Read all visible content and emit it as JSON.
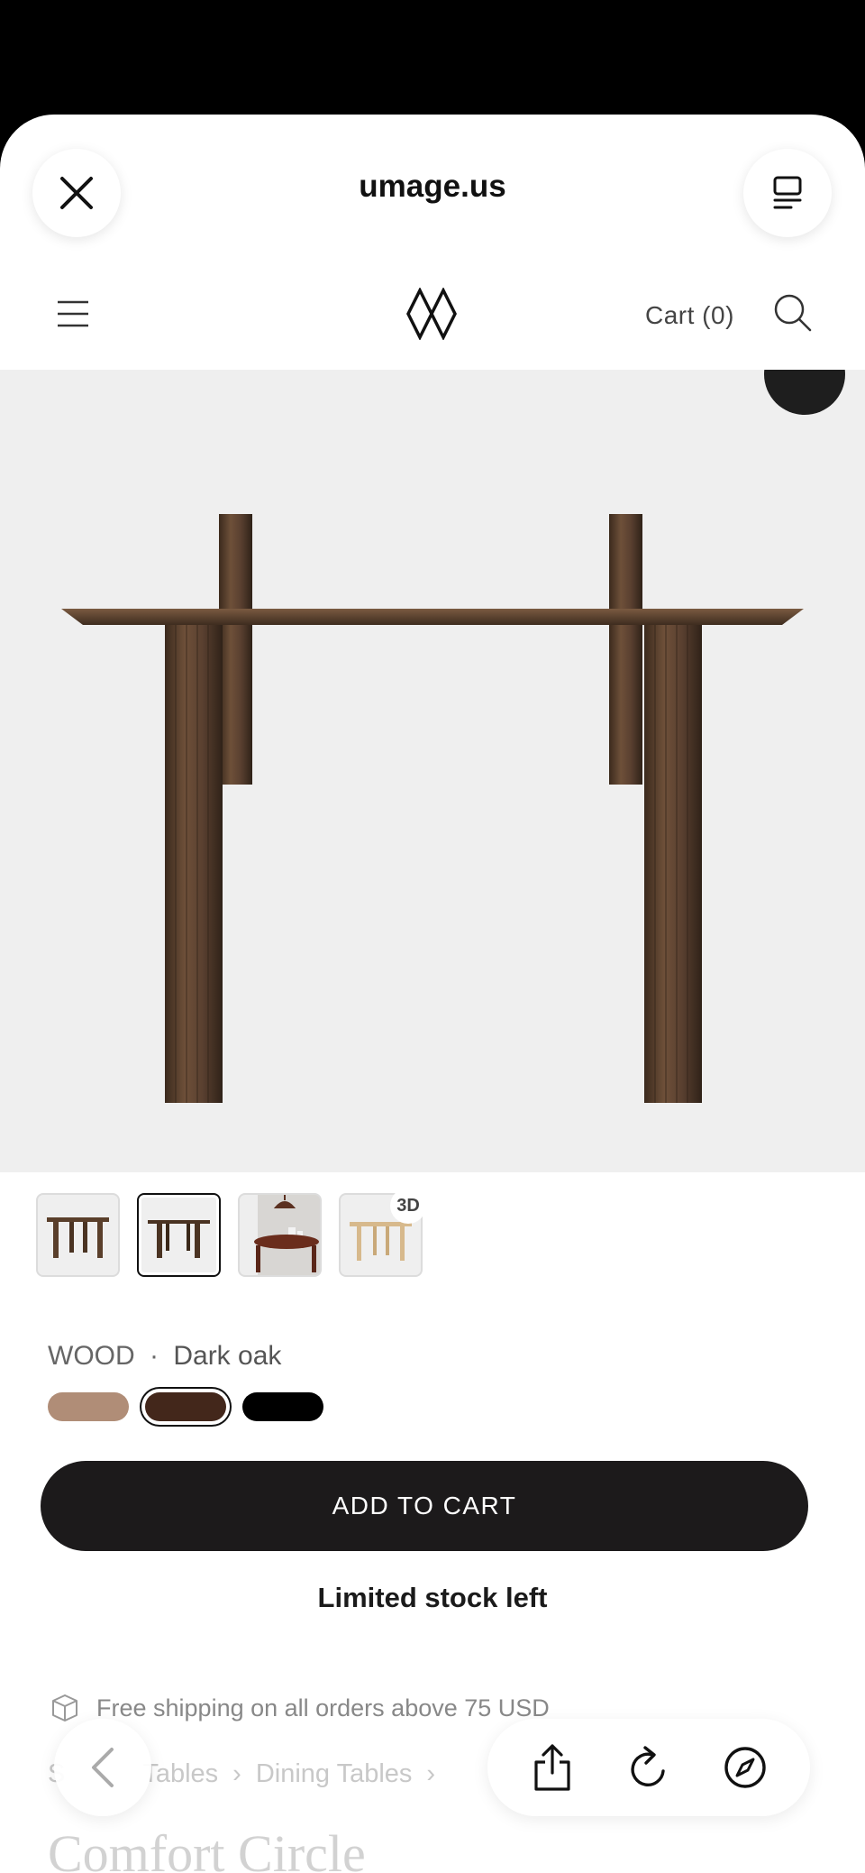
{
  "browser": {
    "url": "umage.us"
  },
  "site": {
    "cart_label": "Cart (0)"
  },
  "gallery": {
    "thumb_badge": "3D"
  },
  "product": {
    "option_label": "WOOD",
    "option_separator": "·",
    "option_value": "Dark oak",
    "swatches": [
      {
        "name": "Light oak",
        "color": "#b08d77"
      },
      {
        "name": "Dark oak",
        "color": "#43271b",
        "selected": true
      },
      {
        "name": "Black",
        "color": "#000000"
      }
    ],
    "add_to_cart": "ADD TO CART",
    "stock_note": "Limited stock left",
    "shipping_note": "Free shipping on all orders above 75 USD",
    "breadcrumb": [
      "S",
      "Tables",
      "Dining Tables"
    ],
    "title": "Comfort Circle"
  },
  "colors": {
    "accent": "#1c1a1b",
    "hero_bg": "#efefef",
    "wood": "#5a3f2b"
  }
}
